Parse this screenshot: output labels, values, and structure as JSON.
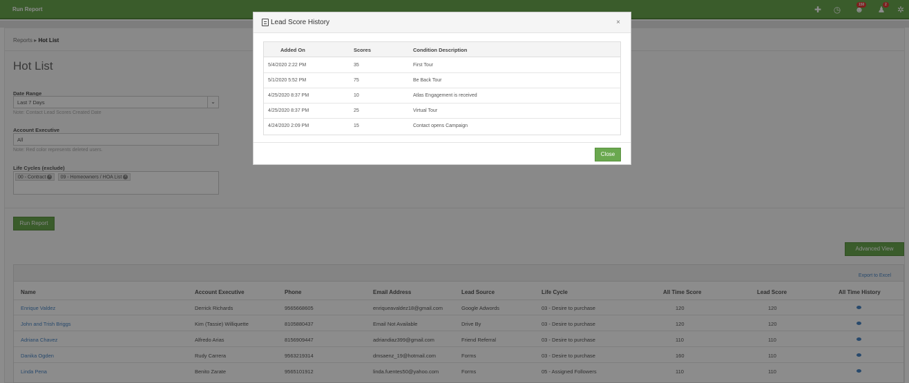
{
  "topbar": {
    "title": "Run Report",
    "notification_badges": [
      "150",
      "2"
    ]
  },
  "breadcrumb": {
    "parent": "Reports",
    "separator": "▸",
    "current": "Hot List"
  },
  "page_title": "Hot List",
  "filters": {
    "date_range": {
      "label": "Date Range",
      "value": "Last 7 Days",
      "note": "Note: Contact Lead Scores Created Date"
    },
    "account_executive": {
      "label": "Account Executive",
      "value": "All",
      "note": "Note: Red color represents deleted users."
    },
    "life_cycles": {
      "label": "Life Cycles (exclude)",
      "tags": [
        "00 - Contract",
        "09 - Homeowners / HOA List"
      ]
    }
  },
  "buttons": {
    "run_report": "Run Report",
    "advanced_view": "Advanced View",
    "export_excel": "Export to Excel"
  },
  "table": {
    "columns": [
      "Name",
      "Account Executive",
      "Phone",
      "Email Address",
      "Lead Source",
      "Life Cycle",
      "All Time Score",
      "Lead Score",
      "All Time History"
    ],
    "rows": [
      [
        "Enrique Valdez",
        "Derrick Richards",
        "9565668605",
        "enriqueavaldez18@gmail.com",
        "Google Adwords",
        "03 - Desire to purchase",
        "120",
        "120"
      ],
      [
        "John and Trish Briggs",
        "Kim (Tassie) Williquette",
        "8105880437",
        "Email Not Available",
        "Drive By",
        "03 - Desire to purchase",
        "120",
        "120"
      ],
      [
        "Adriana Chavez",
        "Alfredo Arias",
        "8156909447",
        "adriandiaz399@gmail.com",
        "Friend Referral",
        "03 - Desire to purchase",
        "110",
        "110"
      ],
      [
        "Danika Ogden",
        "Rudy Carrera",
        "9563219314",
        "dmsaenz_19@hotmail.com",
        "Forms",
        "03 - Desire to purchase",
        "160",
        "110"
      ],
      [
        "Linda Pena",
        "Benito Zarate",
        "9565101912",
        "linda.fuentes50@yahoo.com",
        "Forms",
        "05 - Assigned Followers",
        "110",
        "110"
      ]
    ]
  },
  "modal": {
    "title": "Lead Score History",
    "close_x": "×",
    "close_button": "Close",
    "columns": [
      "Added On",
      "Scores",
      "Condition Description"
    ],
    "rows": [
      [
        "5/4/2020 2:22 PM",
        "35",
        "First Tour"
      ],
      [
        "5/1/2020 5:52 PM",
        "75",
        "Be Back Tour"
      ],
      [
        "4/25/2020 8:37 PM",
        "10",
        "Atlas Engagement is received"
      ],
      [
        "4/25/2020 8:37 PM",
        "25",
        "Virtual Tour"
      ],
      [
        "4/24/2020 2:09 PM",
        "15",
        "Contact opens Campaign"
      ]
    ]
  },
  "colors": {
    "brand_green": "#6aa84f",
    "link_blue": "#4a86c5",
    "badge_red": "#e53935"
  }
}
